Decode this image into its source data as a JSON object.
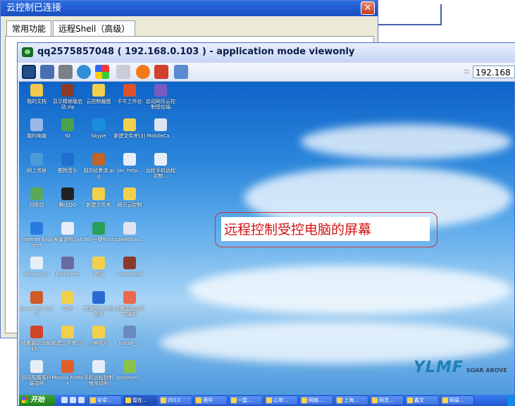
{
  "back_window": {
    "title": "云控制已连接",
    "close_label": "✕",
    "tabs": [
      "常用功能",
      "远程Shell（高级）"
    ]
  },
  "viewer": {
    "title": "qq2575857048 ( 192.168.0.103 ) - application mode viewonly",
    "ip_label": "::",
    "ip_value": "192.168",
    "toolbar_icons": [
      "monitor-icon",
      "window-icon",
      "tools-icon",
      "refresh-icon",
      "windows-flag-icon",
      "keyboard-icon",
      "stop-icon",
      "disconnect-icon",
      "fullscreen-icon"
    ]
  },
  "desktop": {
    "callout_text": "远程控制受控电脑的屏幕",
    "logo_text": "YLMF",
    "logo_sub": "SOAR ABOVE",
    "icons": [
      {
        "label": "我的文档",
        "color": "#f2c94c"
      },
      {
        "label": "显示精修版启动.zip",
        "color": "#8b3a2a"
      },
      {
        "label": "云控制截图",
        "color": "#f2d04c"
      },
      {
        "label": "千牛工作台",
        "color": "#e0502a"
      },
      {
        "label": "启动网页云控制受控端",
        "color": "#7a5ac2"
      },
      {
        "label": "我的电脑",
        "color": "#9ab8e8"
      },
      {
        "label": "IQ",
        "color": "#4aa24a"
      },
      {
        "label": "Skype",
        "color": "#1a8fe0"
      },
      {
        "label": "新建文件夹(3)",
        "color": "#f2d04c"
      },
      {
        "label": "MobileCa...",
        "color": "#dde4ef"
      },
      {
        "label": "网上邻居",
        "color": "#4a9ad8"
      },
      {
        "label": "酷狗音乐",
        "color": "#1f6fd0"
      },
      {
        "label": "副总经参流.jpg",
        "color": "#c0642a"
      },
      {
        "label": "jav_help...",
        "color": "#e8eef8"
      },
      {
        "label": "远程手机远程控制...",
        "color": "#e8eef8"
      },
      {
        "label": "回收站",
        "color": "#5aa95a"
      },
      {
        "label": "腾讯QQ",
        "color": "#222222"
      },
      {
        "label": "新建文件夹",
        "color": "#f2d04c"
      },
      {
        "label": "网页云控制",
        "color": "#f2d04c"
      },
      {
        "label": "Internet Explorer",
        "color": "#2a7be0"
      },
      {
        "label": "安装说明.txt",
        "color": "#e8eef8"
      },
      {
        "label": "360一键Root",
        "color": "#2aa05a"
      },
      {
        "label": "gzwebban...",
        "color": "#dde4ef"
      },
      {
        "label": "nb_sae.cu",
        "color": "#e8eef8"
      },
      {
        "label": "prolly.exe",
        "color": "#6a6aa2"
      },
      {
        "label": "联网",
        "color": "#f2d04c"
      },
      {
        "label": "server.zip",
        "color": "#8b3a2a"
      },
      {
        "label": "Java Web Start",
        "color": "#d05a2a"
      },
      {
        "label": "文档",
        "color": "#f2d04c"
      },
      {
        "label": "有道Phone识别系",
        "color": "#2a6ad0"
      },
      {
        "label": "成都国际火车站通知",
        "color": "#e86a4a"
      },
      {
        "label": "成都路2018010...",
        "color": "#d0442a"
      },
      {
        "label": "新建文件夹(2)",
        "color": "#f2d04c"
      },
      {
        "label": "小熊图片",
        "color": "#f2d04c"
      },
      {
        "label": "Install_...",
        "color": "#6a8ac2"
      },
      {
        "label": "网页配置客户端说明",
        "color": "#e8eef8"
      },
      {
        "label": "Mozilla Firefox",
        "color": "#e0602a"
      },
      {
        "label": "手机远程控制使用说明",
        "color": "#e8eef8"
      },
      {
        "label": "pcserver...",
        "color": "#8bc24a"
      }
    ]
  },
  "taskbar": {
    "start_label": "开始",
    "tasks": [
      "安卓...",
      "雲在...",
      "2013",
      "酒华",
      "~雲...",
      "心常...",
      "网络...",
      "上海...",
      "网灵...",
      "鑫文",
      "网易..."
    ]
  },
  "colors": {
    "accent": "#d01414",
    "titlebar": "#1a4fbf"
  }
}
